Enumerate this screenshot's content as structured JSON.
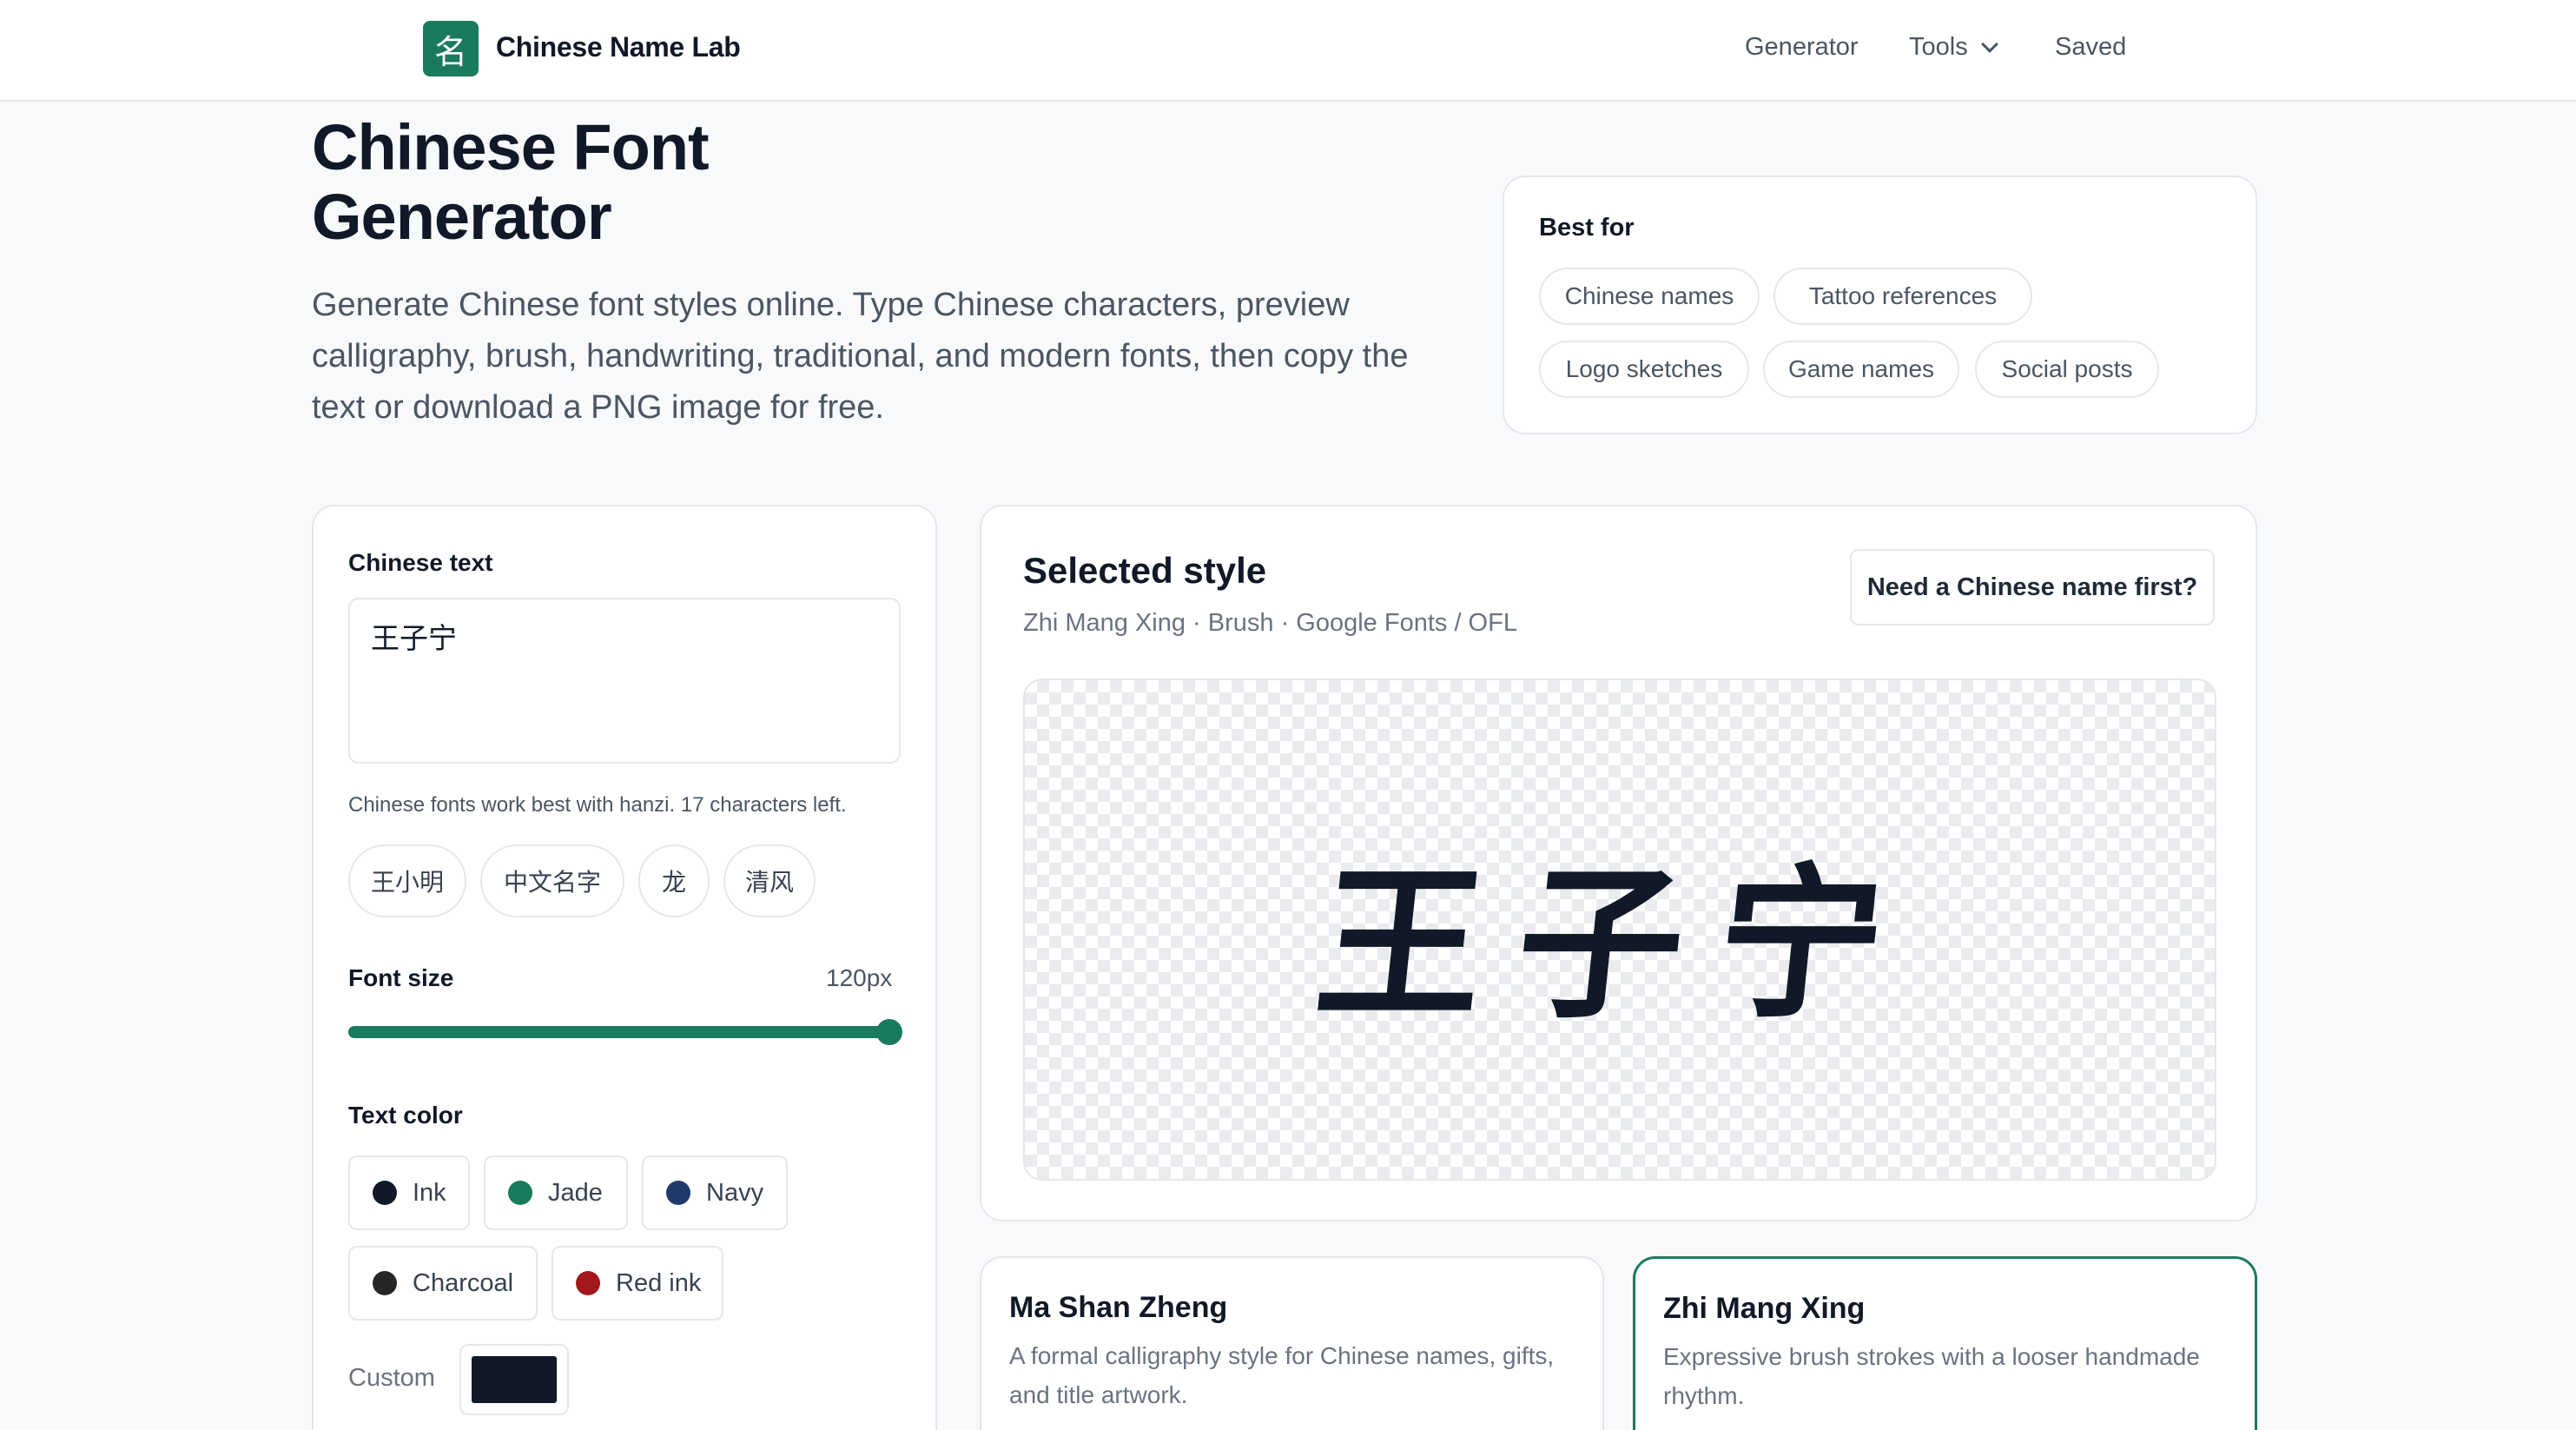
{
  "header": {
    "logo_glyph": "名",
    "brand": "Chinese Name Lab",
    "nav": {
      "generator": "Generator",
      "tools": "Tools",
      "saved": "Saved"
    }
  },
  "hero": {
    "title": "Chinese Font Generator",
    "description": "Generate Chinese font styles online. Type Chinese characters, preview calligraphy, brush, handwriting, traditional, and modern fonts, then copy the text or download a PNG image for free."
  },
  "best_for": {
    "title": "Best for",
    "chips": [
      "Chinese names",
      "Tattoo references",
      "Logo sketches",
      "Game names",
      "Social posts"
    ]
  },
  "editor": {
    "text_label": "Chinese text",
    "text_value": "王子宁",
    "help": "Chinese fonts work best with hanzi. 17 characters left.",
    "samples": [
      "王小明",
      "中文名字",
      "龙",
      "清风"
    ],
    "font_size_label": "Font size",
    "font_size_value": "120px",
    "color_label": "Text color",
    "colors": [
      {
        "name": "Ink",
        "hex": "#111827"
      },
      {
        "name": "Jade",
        "hex": "#1a7a5e"
      },
      {
        "name": "Navy",
        "hex": "#1e3a6b"
      },
      {
        "name": "Charcoal",
        "hex": "#262626"
      },
      {
        "name": "Red ink",
        "hex": "#a3181c"
      }
    ],
    "custom_label": "Custom",
    "custom_color": "#111827"
  },
  "preview": {
    "title": "Selected style",
    "meta": "Zhi Mang Xing · Brush · Google Fonts / OFL",
    "cta": "Need a Chinese name first?",
    "text": "王子宁"
  },
  "fonts": [
    {
      "name": "Ma Shan Zheng",
      "desc": "A formal calligraphy style for Chinese names, gifts, and title artwork."
    },
    {
      "name": "Zhi Mang Xing",
      "desc": "Expressive brush strokes with a looser handmade rhythm."
    }
  ],
  "colors": {
    "accent": "#1a7a5e",
    "border": "#e5e7eb",
    "text": "#111827",
    "muted": "#6b7280"
  }
}
